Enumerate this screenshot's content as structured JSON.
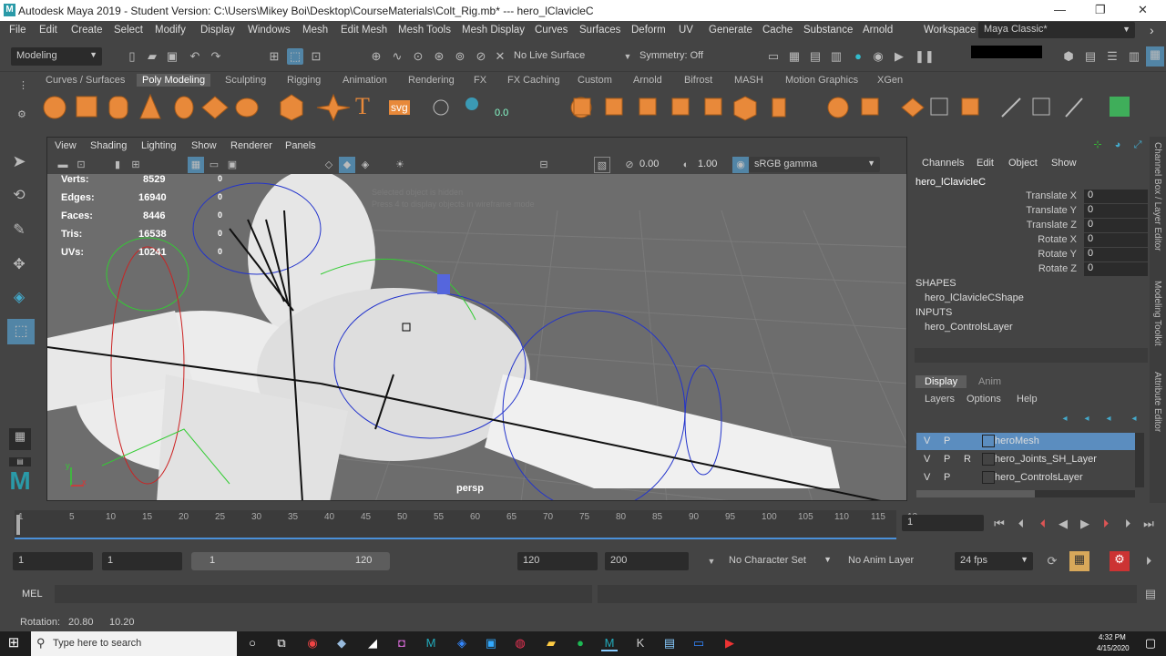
{
  "title_bar": {
    "title": "Autodesk Maya 2019 - Student Version: C:\\Users\\Mikey Boi\\Desktop\\CourseMaterials\\Colt_Rig.mb*   ---   hero_lClavicleC"
  },
  "menu": {
    "items": [
      "File",
      "Edit",
      "Create",
      "Select",
      "Modify",
      "Display",
      "Windows",
      "Mesh",
      "Edit Mesh",
      "Mesh Tools",
      "Mesh Display",
      "Curves",
      "Surfaces",
      "Deform",
      "UV",
      "Generate",
      "Cache",
      "Substance",
      "Arnold"
    ],
    "workspace_label": "Workspace :",
    "workspace_value": "Maya Classic*"
  },
  "status_line": {
    "mode": "Modeling",
    "live_surface": "No Live Surface",
    "symmetry": "Symmetry: Off"
  },
  "shelf": {
    "tabs": [
      "Curves / Surfaces",
      "Poly Modeling",
      "Sculpting",
      "Rigging",
      "Animation",
      "Rendering",
      "FX",
      "FX Caching",
      "Custom",
      "Arnold",
      "Bifrost",
      "MASH",
      "Motion Graphics",
      "XGen"
    ],
    "active_tab": "Poly Modeling",
    "text_icons": {
      "type": "T",
      "svg": "svg",
      "val": "0.0"
    }
  },
  "viewport": {
    "menus": [
      "View",
      "Shading",
      "Lighting",
      "Show",
      "Renderer",
      "Panels"
    ],
    "exposure": "0.00",
    "gamma": "1.00",
    "color_space": "sRGB gamma",
    "camera": "persp",
    "hud": {
      "labels": [
        "Verts:",
        "Edges:",
        "Faces:",
        "Tris:",
        "UVs:"
      ],
      "values": [
        "8529",
        "16940",
        "8446",
        "16538",
        "10241"
      ],
      "zeros": [
        "0",
        "0",
        "0",
        "0",
        "0"
      ]
    },
    "notice1": "Selected object is hidden",
    "notice2": "Press 4 to display objects in wireframe mode"
  },
  "channel_box": {
    "menus": [
      "Channels",
      "Edit",
      "Object",
      "Show"
    ],
    "object": "hero_lClavicleC",
    "attrs": [
      {
        "name": "Translate X",
        "value": "0"
      },
      {
        "name": "Translate Y",
        "value": "0"
      },
      {
        "name": "Translate Z",
        "value": "0"
      },
      {
        "name": "Rotate X",
        "value": "0"
      },
      {
        "name": "Rotate Y",
        "value": "0"
      },
      {
        "name": "Rotate Z",
        "value": "0"
      }
    ],
    "shapes_header": "SHAPES",
    "shape": "hero_lClavicleCShape",
    "inputs_header": "INPUTS",
    "input": "hero_ControlsLayer"
  },
  "layer_editor": {
    "tabs": [
      "Display",
      "Anim"
    ],
    "menus": [
      "Layers",
      "Options",
      "Help"
    ],
    "layers": [
      {
        "v": "V",
        "p": "P",
        "r": "",
        "name": "heroMesh"
      },
      {
        "v": "V",
        "p": "P",
        "r": "R",
        "name": "hero_Joints_SH_Layer"
      },
      {
        "v": "V",
        "p": "P",
        "r": "",
        "name": "hero_ControlsLayer"
      }
    ]
  },
  "side_tabs": [
    "Channel Box / Layer Editor",
    "Modeling Toolkit",
    "Attribute Editor"
  ],
  "timeline": {
    "ticks": [
      "1",
      "5",
      "10",
      "15",
      "20",
      "25",
      "30",
      "35",
      "40",
      "45",
      "50",
      "55",
      "60",
      "65",
      "70",
      "75",
      "80",
      "85",
      "90",
      "95",
      "100",
      "105",
      "110",
      "115",
      "12"
    ],
    "current_frame": "1"
  },
  "range": {
    "start": "1",
    "playback_start": "1",
    "slider_start": "1",
    "slider_end": "120",
    "playback_end": "120",
    "end": "200",
    "character_set": "No Character Set",
    "anim_layer": "No Anim Layer",
    "fps": "24 fps"
  },
  "mel": {
    "label": "MEL"
  },
  "help_line": {
    "label": "Rotation:",
    "v1": "20.80",
    "v2": "10.20"
  },
  "taskbar": {
    "search": "Type here to search",
    "time": "4:32 PM",
    "date": "4/15/2020"
  },
  "colors": {
    "accent": "#5285a6",
    "active_tab": "#5d5d5d",
    "viewport_bg": "#6d6d6d",
    "selection": "#4a7fb5"
  }
}
